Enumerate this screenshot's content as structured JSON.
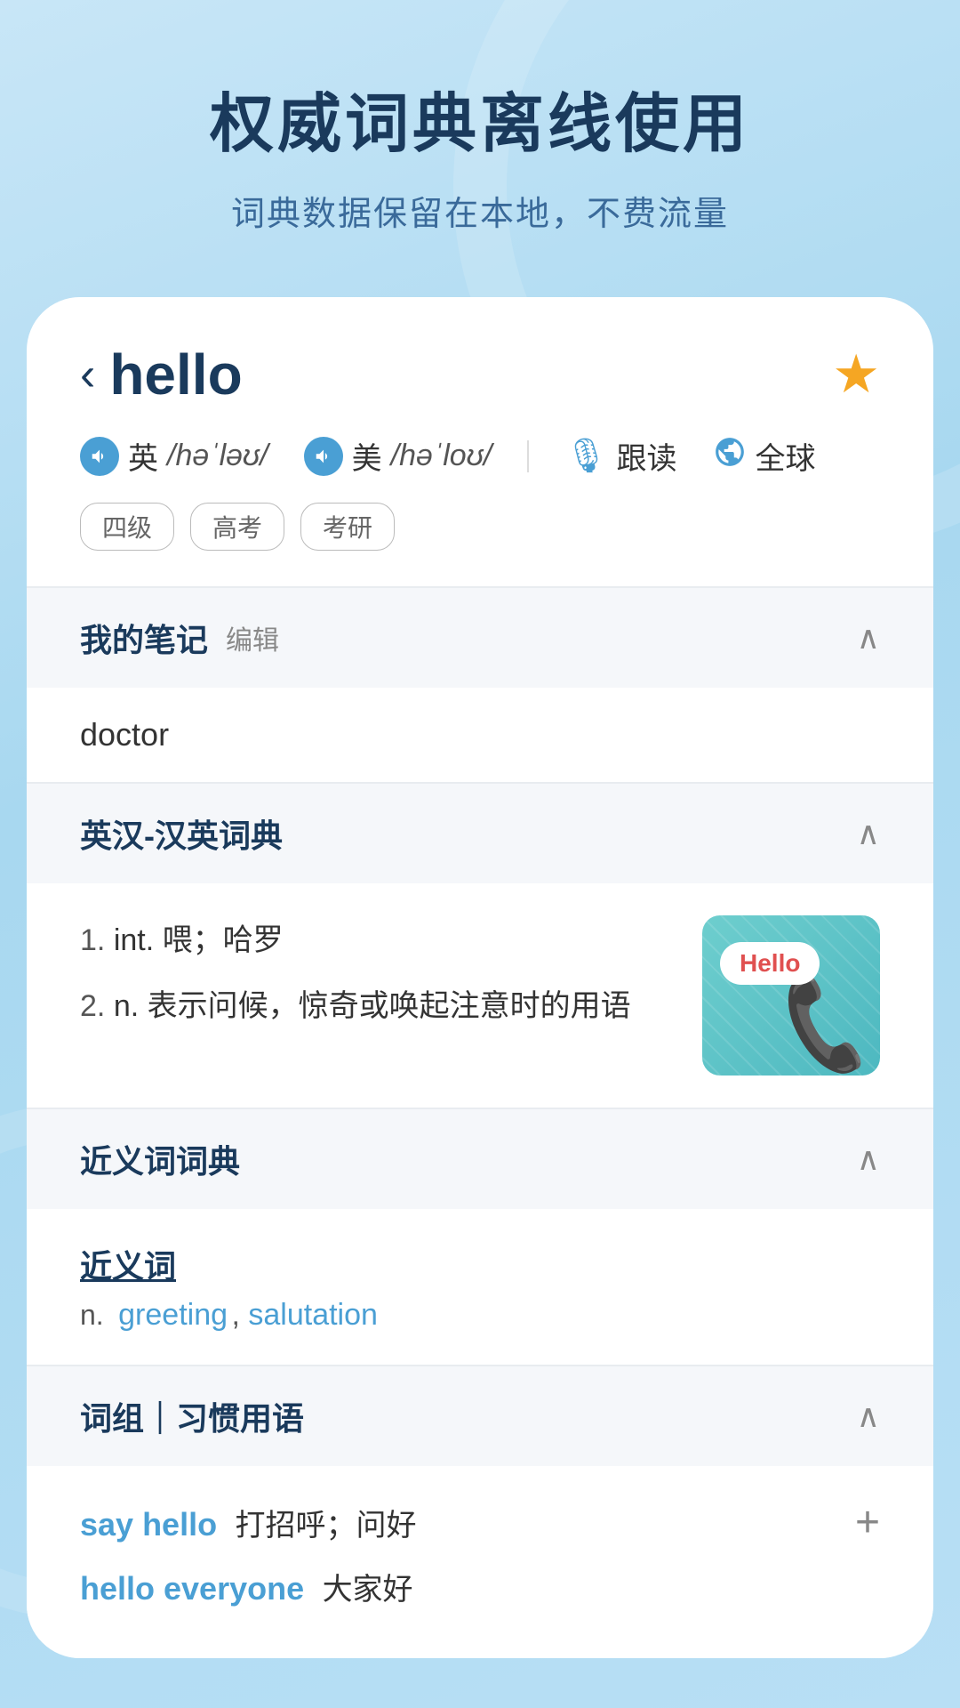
{
  "background": {
    "gradient_start": "#c8e6f7",
    "gradient_end": "#a8d8f0"
  },
  "header": {
    "title": "权威词典离线使用",
    "subtitle": "词典数据保留在本地，不费流量"
  },
  "word_card": {
    "back_label": "‹",
    "word": "hello",
    "star_label": "★",
    "phonetic": {
      "british": {
        "flag": "英",
        "ipa": "/həˈləʊ/"
      },
      "american": {
        "flag": "美",
        "ipa": "/həˈloʊ/"
      },
      "follow_label": "跟读",
      "global_label": "全球"
    },
    "tags": [
      "四级",
      "高考",
      "考研"
    ]
  },
  "sections": {
    "notes": {
      "title": "我的笔记",
      "edit_label": "编辑",
      "chevron": "∧",
      "content": "doctor"
    },
    "dictionary": {
      "title": "英汉-汉英词典",
      "chevron": "∧",
      "entries": [
        {
          "num": "1.",
          "pos": "int.",
          "def": "喂；哈罗"
        },
        {
          "num": "2.",
          "pos": "n.",
          "def": "表示问候，惊奇或唤起注意时的用语"
        }
      ],
      "image_alt": "Hello telephone illustration",
      "image_bubble": "Hello",
      "image_phone_emoji": "📞"
    },
    "synonyms": {
      "title": "近义词词典",
      "chevron": "∧",
      "subtitle": "近义词",
      "label": "n.",
      "links": [
        "greeting",
        "salutation"
      ]
    },
    "phrases": {
      "title": "词组｜习惯用语",
      "chevron": "∧",
      "items": [
        {
          "english": "say hello",
          "chinese": "打招呼；问好",
          "has_add": true
        },
        {
          "english": "hello everyone",
          "chinese": "大家好",
          "has_add": false
        }
      ]
    }
  }
}
